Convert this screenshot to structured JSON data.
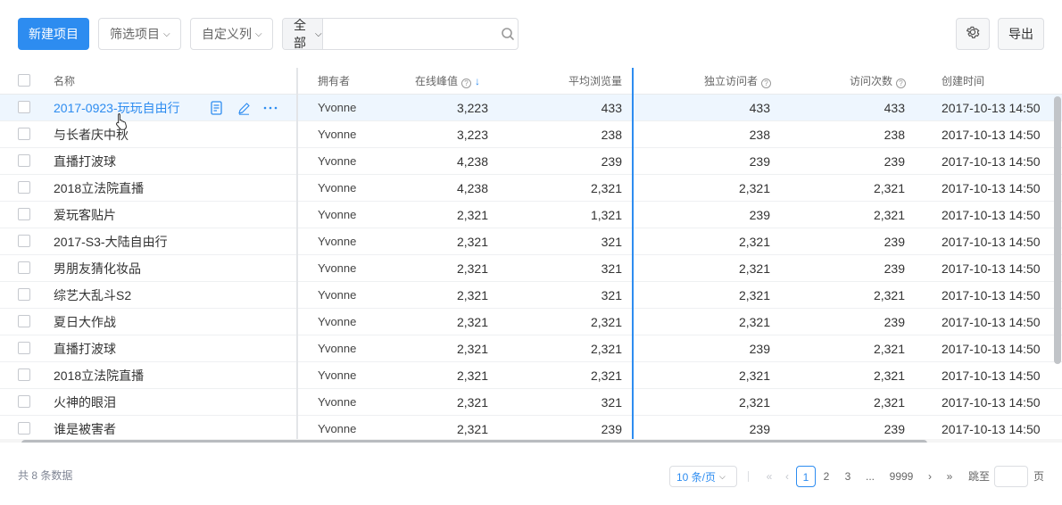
{
  "toolbar": {
    "new_button": "新建项目",
    "filter_dropdown": "筛选项目",
    "columns_dropdown": "自定义列",
    "search_scope": "全部",
    "search_placeholder": "",
    "export_button": "导出"
  },
  "table": {
    "columns": {
      "name": "名称",
      "owner": "拥有者",
      "peak": "在线峰值",
      "avg_views": "平均浏览量",
      "visitors": "独立访问者",
      "visits": "访问次数",
      "created": "创建时间"
    },
    "sorted_column": "peak",
    "sort_direction": "descending",
    "rows": [
      {
        "name": "2017-0923-玩玩自由行",
        "owner": "Yvonne",
        "peak": "3,223",
        "avg": "433",
        "visitors": "433",
        "visits": "433",
        "created": "2017-10-13 14:50"
      },
      {
        "name": "与长者庆中秋",
        "owner": "Yvonne",
        "peak": "3,223",
        "avg": "238",
        "visitors": "238",
        "visits": "238",
        "created": "2017-10-13 14:50"
      },
      {
        "name": "直播打波球",
        "owner": "Yvonne",
        "peak": "4,238",
        "avg": "239",
        "visitors": "239",
        "visits": "239",
        "created": "2017-10-13 14:50"
      },
      {
        "name": "2018立法院直播",
        "owner": "Yvonne",
        "peak": "4,238",
        "avg": "2,321",
        "visitors": "2,321",
        "visits": "2,321",
        "created": "2017-10-13 14:50"
      },
      {
        "name": "爱玩客贴片",
        "owner": "Yvonne",
        "peak": "2,321",
        "avg": "1,321",
        "visitors": "239",
        "visits": "2,321",
        "created": "2017-10-13 14:50"
      },
      {
        "name": "2017-S3-大陆自由行",
        "owner": "Yvonne",
        "peak": "2,321",
        "avg": "321",
        "visitors": "2,321",
        "visits": "239",
        "created": "2017-10-13 14:50"
      },
      {
        "name": "男朋友猜化妆品",
        "owner": "Yvonne",
        "peak": "2,321",
        "avg": "321",
        "visitors": "2,321",
        "visits": "239",
        "created": "2017-10-13 14:50"
      },
      {
        "name": "综艺大乱斗S2",
        "owner": "Yvonne",
        "peak": "2,321",
        "avg": "321",
        "visitors": "2,321",
        "visits": "2,321",
        "created": "2017-10-13 14:50"
      },
      {
        "name": "夏日大作战",
        "owner": "Yvonne",
        "peak": "2,321",
        "avg": "2,321",
        "visitors": "2,321",
        "visits": "239",
        "created": "2017-10-13 14:50"
      },
      {
        "name": "直播打波球",
        "owner": "Yvonne",
        "peak": "2,321",
        "avg": "2,321",
        "visitors": "239",
        "visits": "2,321",
        "created": "2017-10-13 14:50"
      },
      {
        "name": "2018立法院直播",
        "owner": "Yvonne",
        "peak": "2,321",
        "avg": "2,321",
        "visitors": "2,321",
        "visits": "2,321",
        "created": "2017-10-13 14:50"
      },
      {
        "name": "火神的眼泪",
        "owner": "Yvonne",
        "peak": "2,321",
        "avg": "321",
        "visitors": "2,321",
        "visits": "2,321",
        "created": "2017-10-13 14:50"
      },
      {
        "name": "谁是被害者",
        "owner": "Yvonne",
        "peak": "2,321",
        "avg": "239",
        "visitors": "239",
        "visits": "239",
        "created": "2017-10-13 14:50"
      }
    ]
  },
  "footer": {
    "total_text": "共 8 条数据",
    "page_size": "10 条/页",
    "pages": [
      "1",
      "2",
      "3",
      "...",
      "9999"
    ],
    "current_page": "1",
    "jump_label": "跳至",
    "jump_unit": "页"
  },
  "colors": {
    "primary": "#2d8cf0",
    "row_hover": "#eef6fe"
  },
  "icons": {
    "search": "search-icon",
    "settings": "gear-icon",
    "row_detail": "document-icon",
    "row_edit": "pencil-icon",
    "row_more": "ellipsis-icon"
  }
}
